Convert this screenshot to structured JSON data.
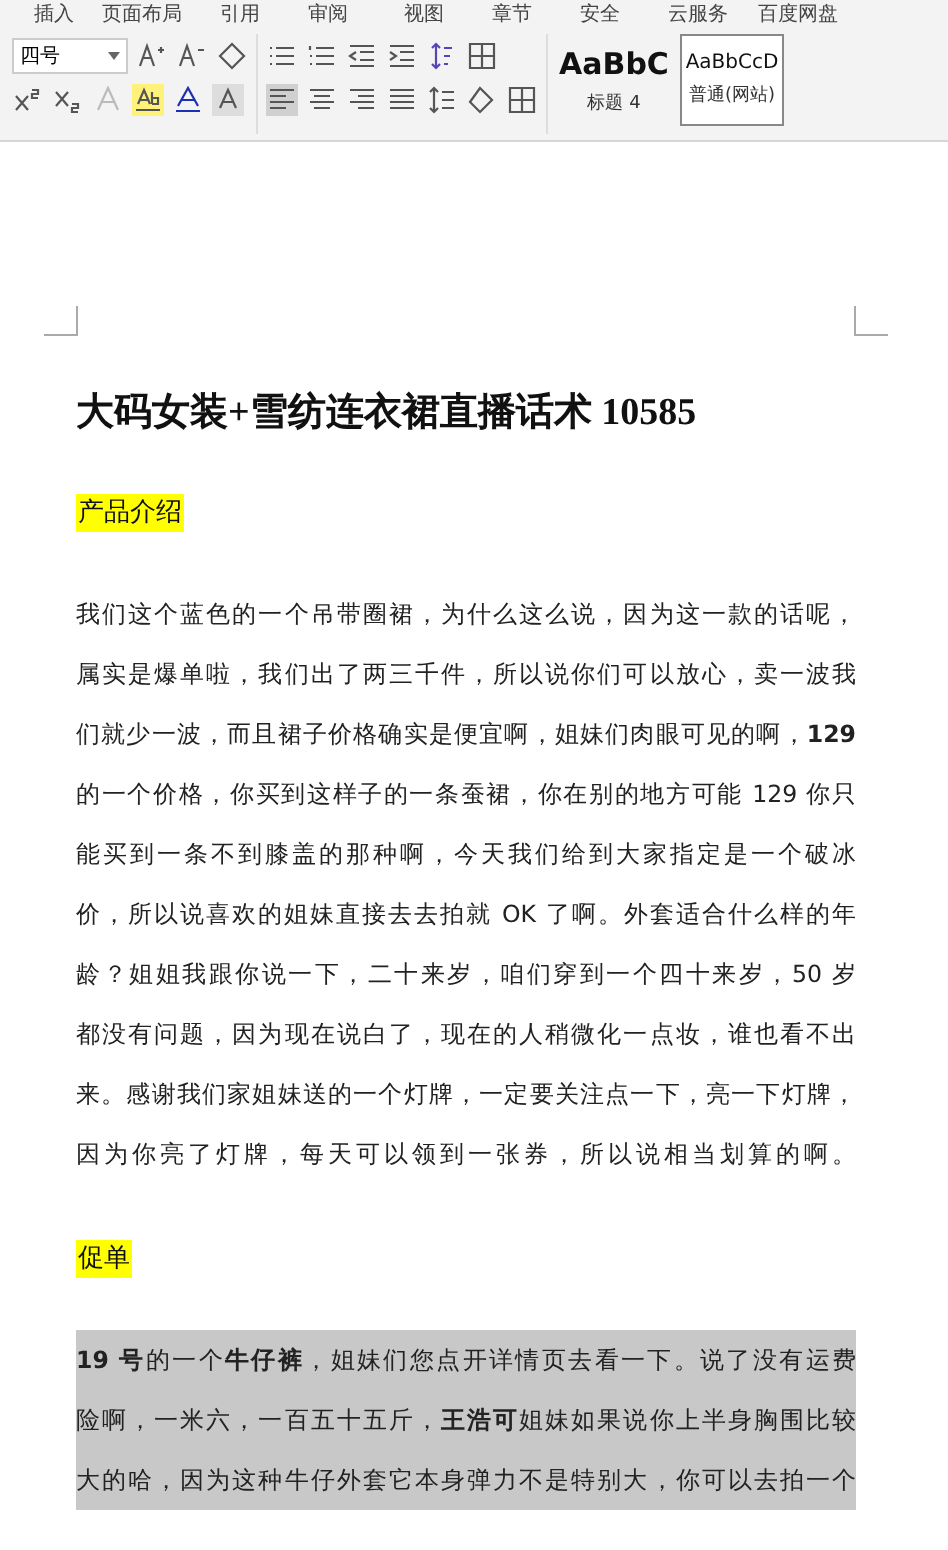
{
  "menu_tabs": [
    {
      "label": "插入",
      "selected": false
    },
    {
      "label": "页面布局",
      "selected": false
    },
    {
      "label": "引用",
      "selected": false
    },
    {
      "label": "审阅",
      "selected": false
    },
    {
      "label": "视图",
      "selected": false
    },
    {
      "label": "章节",
      "selected": false
    },
    {
      "label": "安全",
      "selected": false
    },
    {
      "label": "云服务",
      "selected": false
    },
    {
      "label": "百度网盘",
      "selected": false
    }
  ],
  "font_size": {
    "value": "四号"
  },
  "styles": [
    {
      "sample": "AaBbC",
      "name": "标题 4",
      "selected": false,
      "kind": "heading"
    },
    {
      "sample": "AaBbCcD",
      "name": "普通(网站)",
      "selected": true,
      "kind": "normal"
    }
  ],
  "document": {
    "title": "大码女装+雪纺连衣裙直播话术 10585",
    "blocks": [
      {
        "kind": "heading",
        "text": "产品介绍"
      },
      {
        "kind": "paragraph",
        "selected": false,
        "lines": [
          "我们这个蓝色的一个吊带圈裙，为什么这么说，因为这一款的话呢，",
          "属实是爆单啦，我们出了两三千件，所以说你们可以放心，卖一波我",
          "们就少一波，而且裙子价格确实是便宜啊，姐妹们肉眼可见的啊，**129**",
          "的一个价格，你买到这样子的一条蚕裙，你在别的地方可能 129 你只",
          "能买到一条不到膝盖的那种啊，今天我们给到大家指定是一个破冰",
          "价，所以说喜欢的姐妹直接去去拍就 OK 了啊。外套适合什么样的年",
          "龄？姐姐我跟你说一下，二十来岁，咱们穿到一个四十来岁，50 岁",
          "都没有问题，因为现在说白了，现在的人稍微化一点妆，谁也看不出",
          "来。感谢我们家姐妹送的一个灯牌，一定要关注点一下，亮一下灯牌，",
          "因为你亮了灯牌，每天可以领到一张券，所以说相当划算的啊。"
        ]
      },
      {
        "kind": "heading",
        "text": "促单"
      },
      {
        "kind": "paragraph",
        "selected": true,
        "lines": [
          "**19 号**的一个**牛仔裤**，姐妹们您点开详情页去看一下。说了没有运费",
          "险啊，一米六，一百五十五斤，**王浩可**姐妹如果说你上半身胸围比较",
          "大的哈，因为这种牛仔外套它本身弹力不是特别大，你可以去拍一个"
        ]
      }
    ]
  }
}
